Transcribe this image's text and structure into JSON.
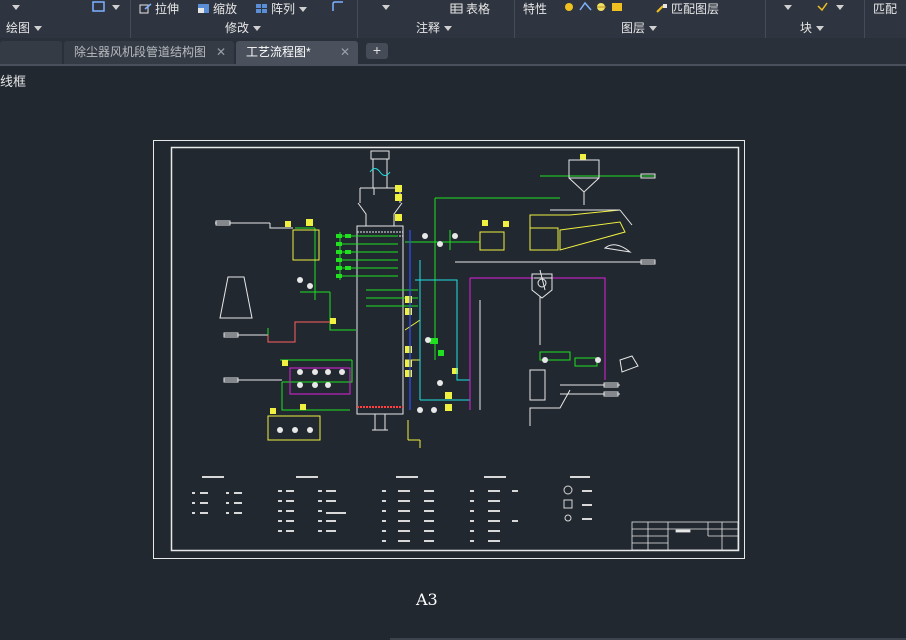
{
  "ribbon": {
    "groups": [
      {
        "title": "绘图",
        "items": []
      },
      {
        "title": "修改",
        "items": [
          "拉伸",
          "缩放",
          "阵列"
        ]
      },
      {
        "title": "注释",
        "items": [
          "表格"
        ]
      },
      {
        "title": "图层",
        "items": [
          "特性",
          "匹配图层"
        ]
      },
      {
        "title": "块",
        "items": []
      },
      {
        "title": "",
        "items": [
          "匹配"
        ]
      }
    ]
  },
  "tabs": [
    {
      "label": "",
      "active": false
    },
    {
      "label": "除尘器风机段管道结构图",
      "active": false
    },
    {
      "label": "工艺流程图*",
      "active": true
    }
  ],
  "viewport": {
    "label": "线框"
  },
  "drawing": {
    "sheet_size": "A3"
  },
  "colors": {
    "background": "#212830",
    "ribbon": "#2f3540",
    "green": "#20e020",
    "yellow": "#f0f040",
    "magenta": "#e020e0",
    "cyan": "#20e0e0",
    "red": "#ff5050"
  }
}
